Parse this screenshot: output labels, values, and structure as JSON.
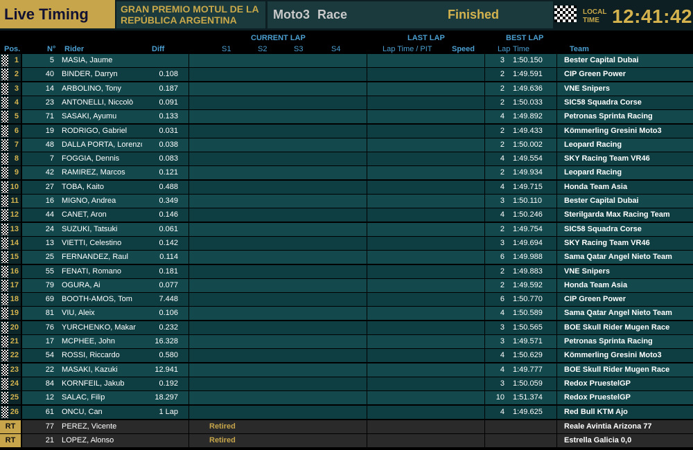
{
  "header": {
    "app_title": "Live Timing",
    "event_line1": "GRAN PREMIO MOTUL DE LA",
    "event_line2": "REPÚBLICA ARGENTINA",
    "class": "Moto3",
    "session": "Race",
    "status": "Finished",
    "local_label_line1": "LOCAL",
    "local_label_line2": "TIME",
    "local_time": "12:41:42",
    "flag_icon": "checkered-flag-icon"
  },
  "columns": {
    "pos": "Pos.",
    "num": "N°",
    "rider": "Rider",
    "diff": "Diff",
    "current_lap": "CURRENT LAP",
    "s1": "S1",
    "s2": "S2",
    "s3": "S3",
    "s4": "S4",
    "last_lap": "LAST LAP",
    "lap_time_pit": "Lap Time / PIT",
    "speed": "Speed",
    "best_lap": "BEST LAP",
    "lap": "Lap",
    "time": "Time",
    "team": "Team"
  },
  "colors": {
    "gold": "#c6a54b",
    "row_bg_1": "#13494d",
    "row_bg_2": "#0f3e42",
    "retired_row_bg": "#2a2a2a",
    "header_blue": "#4b9fd0"
  },
  "rows": [
    {
      "pos": "1",
      "num": "5",
      "rider": "MASIA, Jaume",
      "diff": "",
      "lap": "3",
      "best": "1:50.150",
      "team": "Bester Capital Dubai"
    },
    {
      "pos": "2",
      "num": "40",
      "rider": "BINDER, Darryn",
      "diff": "0.108",
      "lap": "2",
      "best": "1:49.591",
      "team": "CIP Green Power"
    },
    {
      "pos": "3",
      "num": "14",
      "rider": "ARBOLINO, Tony",
      "diff": "0.187",
      "lap": "2",
      "best": "1:49.636",
      "team": "VNE Snipers"
    },
    {
      "pos": "4",
      "num": "23",
      "rider": "ANTONELLI, Niccolò",
      "diff": "0.091",
      "lap": "2",
      "best": "1:50.033",
      "team": "SIC58 Squadra Corse"
    },
    {
      "pos": "5",
      "num": "71",
      "rider": "SASAKI, Ayumu",
      "diff": "0.133",
      "lap": "4",
      "best": "1:49.892",
      "team": "Petronas Sprinta Racing"
    },
    {
      "pos": "6",
      "num": "19",
      "rider": "RODRIGO, Gabriel",
      "diff": "0.031",
      "lap": "2",
      "best": "1:49.433",
      "team": "Kömmerling Gresini Moto3"
    },
    {
      "pos": "7",
      "num": "48",
      "rider": "DALLA PORTA, Lorenzo",
      "diff": "0.038",
      "lap": "2",
      "best": "1:50.002",
      "team": "Leopard Racing"
    },
    {
      "pos": "8",
      "num": "7",
      "rider": "FOGGIA, Dennis",
      "diff": "0.083",
      "lap": "4",
      "best": "1:49.554",
      "team": "SKY Racing Team VR46"
    },
    {
      "pos": "9",
      "num": "42",
      "rider": "RAMIREZ, Marcos",
      "diff": "0.121",
      "lap": "2",
      "best": "1:49.934",
      "team": "Leopard Racing"
    },
    {
      "pos": "10",
      "num": "27",
      "rider": "TOBA, Kaito",
      "diff": "0.488",
      "lap": "4",
      "best": "1:49.715",
      "team": "Honda Team Asia"
    },
    {
      "pos": "11",
      "num": "16",
      "rider": "MIGNO, Andrea",
      "diff": "0.349",
      "lap": "3",
      "best": "1:50.110",
      "team": "Bester Capital Dubai"
    },
    {
      "pos": "12",
      "num": "44",
      "rider": "CANET, Aron",
      "diff": "0.146",
      "lap": "4",
      "best": "1:50.246",
      "team": "Sterilgarda Max Racing Team"
    },
    {
      "pos": "13",
      "num": "24",
      "rider": "SUZUKI, Tatsuki",
      "diff": "0.061",
      "lap": "2",
      "best": "1:49.754",
      "team": "SIC58 Squadra Corse"
    },
    {
      "pos": "14",
      "num": "13",
      "rider": "VIETTI, Celestino",
      "diff": "0.142",
      "lap": "3",
      "best": "1:49.694",
      "team": "SKY Racing Team VR46"
    },
    {
      "pos": "15",
      "num": "25",
      "rider": "FERNANDEZ, Raul",
      "diff": "0.114",
      "lap": "6",
      "best": "1:49.988",
      "team": "Sama Qatar Angel Nieto Team"
    },
    {
      "pos": "16",
      "num": "55",
      "rider": "FENATI, Romano",
      "diff": "0.181",
      "lap": "2",
      "best": "1:49.883",
      "team": "VNE Snipers"
    },
    {
      "pos": "17",
      "num": "79",
      "rider": "OGURA, Ai",
      "diff": "0.077",
      "lap": "2",
      "best": "1:49.592",
      "team": "Honda Team Asia"
    },
    {
      "pos": "18",
      "num": "69",
      "rider": "BOOTH-AMOS, Tom",
      "diff": "7.448",
      "lap": "6",
      "best": "1:50.770",
      "team": "CIP Green Power"
    },
    {
      "pos": "19",
      "num": "81",
      "rider": "VIU, Aleix",
      "diff": "0.106",
      "lap": "4",
      "best": "1:50.589",
      "team": "Sama Qatar Angel Nieto Team"
    },
    {
      "pos": "20",
      "num": "76",
      "rider": "YURCHENKO, Makar",
      "diff": "0.232",
      "lap": "3",
      "best": "1:50.565",
      "team": "BOE Skull Rider Mugen Race"
    },
    {
      "pos": "21",
      "num": "17",
      "rider": "MCPHEE, John",
      "diff": "16.328",
      "lap": "3",
      "best": "1:49.571",
      "team": "Petronas Sprinta Racing"
    },
    {
      "pos": "22",
      "num": "54",
      "rider": "ROSSI, Riccardo",
      "diff": "0.580",
      "lap": "4",
      "best": "1:50.629",
      "team": "Kömmerling Gresini Moto3"
    },
    {
      "pos": "23",
      "num": "22",
      "rider": "MASAKI, Kazuki",
      "diff": "12.941",
      "lap": "4",
      "best": "1:49.777",
      "team": "BOE Skull Rider Mugen Race"
    },
    {
      "pos": "24",
      "num": "84",
      "rider": "KORNFEIL, Jakub",
      "diff": "0.192",
      "lap": "3",
      "best": "1:50.059",
      "team": "Redox PruestelGP"
    },
    {
      "pos": "25",
      "num": "12",
      "rider": "SALAC, Filip",
      "diff": "18.297",
      "lap": "10",
      "best": "1:51.374",
      "team": "Redox PruestelGP"
    },
    {
      "pos": "26",
      "num": "61",
      "rider": "ONCU, Can",
      "diff": "1 Lap",
      "lap": "4",
      "best": "1:49.625",
      "team": "Red Bull KTM Ajo"
    }
  ],
  "retired": [
    {
      "pos": "RT",
      "num": "77",
      "rider": "PEREZ, Vicente",
      "status": "Retired",
      "team": "Reale Avintia Arizona 77"
    },
    {
      "pos": "RT",
      "num": "21",
      "rider": "LOPEZ, Alonso",
      "status": "Retired",
      "team": "Estrella Galicia 0,0"
    }
  ]
}
